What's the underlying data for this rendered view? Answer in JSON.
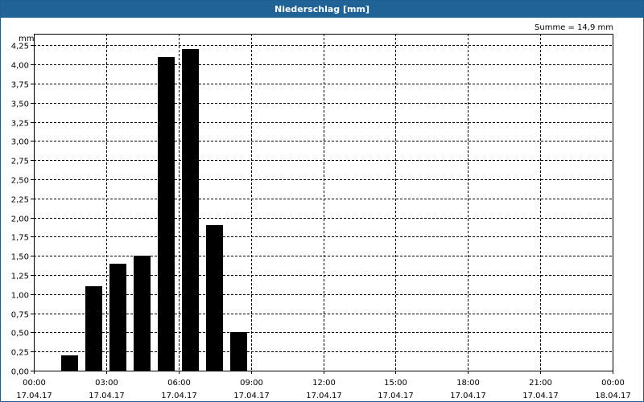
{
  "window": {
    "title": "Niederschlag [mm]"
  },
  "chart_data": {
    "type": "bar",
    "title": "Niederschlag [mm]",
    "ylabel": "mm",
    "xlabel": "",
    "summary": "Summe = 14,9 mm",
    "ylim": [
      0,
      4.4
    ],
    "xlim_hours": [
      0,
      24
    ],
    "grid": true,
    "y_ticks": [
      "0,00",
      "0,25",
      "0,50",
      "0,75",
      "1,00",
      "1,25",
      "1,50",
      "1,75",
      "2,00",
      "2,25",
      "2,50",
      "2,75",
      "3,00",
      "3,25",
      "3,50",
      "3,75",
      "4,00",
      "4,25"
    ],
    "x_ticks": [
      {
        "time": "00:00",
        "date": "17.04.17"
      },
      {
        "time": "03:00",
        "date": "17.04.17"
      },
      {
        "time": "06:00",
        "date": "17.04.17"
      },
      {
        "time": "09:00",
        "date": "17.04.17"
      },
      {
        "time": "12:00",
        "date": "17.04.17"
      },
      {
        "time": "15:00",
        "date": "17.04.17"
      },
      {
        "time": "18:00",
        "date": "17.04.17"
      },
      {
        "time": "21:00",
        "date": "17.04.17"
      },
      {
        "time": "00:00",
        "date": "18.04.17"
      }
    ],
    "bars": [
      {
        "hour": 1.5,
        "value": 0.2
      },
      {
        "hour": 2.5,
        "value": 1.1
      },
      {
        "hour": 3.5,
        "value": 1.4
      },
      {
        "hour": 4.5,
        "value": 1.5
      },
      {
        "hour": 5.5,
        "value": 4.1
      },
      {
        "hour": 6.5,
        "value": 4.2
      },
      {
        "hour": 7.5,
        "value": 1.9
      },
      {
        "hour": 8.5,
        "value": 0.5
      }
    ],
    "bar_color": "#000000"
  }
}
